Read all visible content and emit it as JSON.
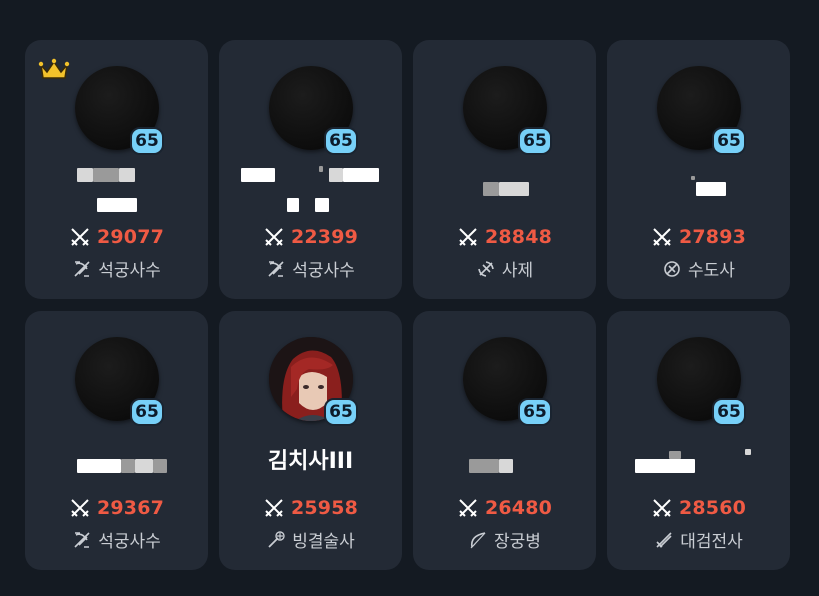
{
  "colors": {
    "background": "#141a22",
    "card": "#232a35",
    "level_badge": "#77d0f8",
    "power": "#ef5a44",
    "job_text": "#c9cdd3",
    "crown": "#f3c22b"
  },
  "cards": [
    {
      "level": "65",
      "name": "",
      "power": "29077",
      "job": "석궁사수",
      "job_icon": "crossbow-icon",
      "crown": true
    },
    {
      "level": "65",
      "name": "",
      "power": "22399",
      "job": "석궁사수",
      "job_icon": "crossbow-icon",
      "crown": false
    },
    {
      "level": "65",
      "name": "",
      "power": "28848",
      "job": "사제",
      "job_icon": "priest-icon",
      "crown": false
    },
    {
      "level": "65",
      "name": "",
      "power": "27893",
      "job": "수도사",
      "job_icon": "monk-icon",
      "crown": false
    },
    {
      "level": "65",
      "name": "",
      "power": "29367",
      "job": "석궁사수",
      "job_icon": "crossbow-icon",
      "crown": false
    },
    {
      "level": "65",
      "name": "김치사III",
      "power": "25958",
      "job": "빙결술사",
      "job_icon": "ice-mage-icon",
      "crown": false
    },
    {
      "level": "65",
      "name": "",
      "power": "26480",
      "job": "장궁병",
      "job_icon": "longbow-icon",
      "crown": false
    },
    {
      "level": "65",
      "name": "",
      "power": "28560",
      "job": "대검전사",
      "job_icon": "greatsword-icon",
      "crown": false
    }
  ]
}
